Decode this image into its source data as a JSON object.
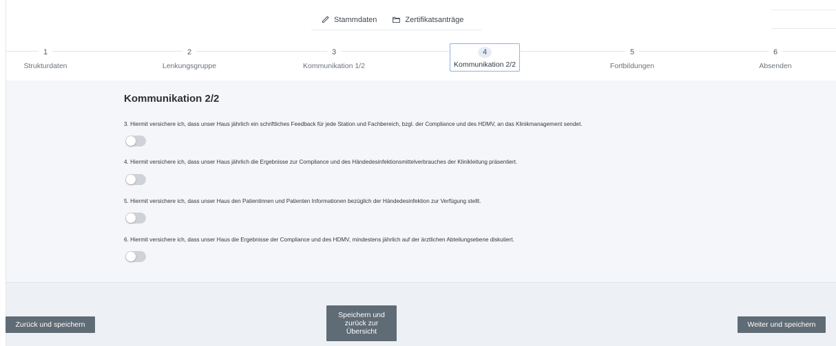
{
  "topnav": {
    "items": [
      {
        "label": "Stammdaten",
        "icon": "pencil-icon"
      },
      {
        "label": "Zertifikatsanträge",
        "icon": "folder-icon"
      }
    ]
  },
  "stepper": {
    "steps": [
      {
        "num": "1",
        "label": "Strukturdaten"
      },
      {
        "num": "2",
        "label": "Lenkungsgruppe"
      },
      {
        "num": "3",
        "label": "Kommunikation 1/2"
      },
      {
        "num": "4",
        "label": "Kommunikation 2/2"
      },
      {
        "num": "5",
        "label": "Fortbildungen"
      },
      {
        "num": "6",
        "label": "Absenden"
      }
    ],
    "active": "4"
  },
  "main": {
    "title": "Kommunikation 2/2",
    "questions": [
      {
        "text": "3. Hiermit versichere ich, dass unser Haus jährlich ein schriftliches Feedback für jede Station und Fachbereich, bzgl. der Compliance und des HDMV, an das Klinikmanagement sendet.",
        "toggle": false
      },
      {
        "text": "4. Hiermit versichere ich, dass unser Haus jährlich die Ergebnisse zur Compliance und des Händedesinfektionsmittelverbrauches der Klinikleitung präsentiert.",
        "toggle": false
      },
      {
        "text": "5. Hiermit versichere ich, dass unser Haus den Patientinnen und Patienten Informationen bezüglich der Händedesinfektion zur Verfügung stellt.",
        "toggle": false
      },
      {
        "text": "6. Hiermit versichere ich, dass unser Haus die Ergebnisse der Compliance und des HDMV, mindestens jährlich auf der ärztlichen Abteilungsebene diskutiert.",
        "toggle": false
      }
    ]
  },
  "footer": {
    "back_label": "Zurück und speichern",
    "overview_label": "Speichern und zurück zur Übersicht",
    "next_label": "Weiter und speichern"
  },
  "colors": {
    "button": "#5f6b75",
    "content_bg": "#f4f6f9",
    "active_step_border": "#8ab4e8"
  }
}
